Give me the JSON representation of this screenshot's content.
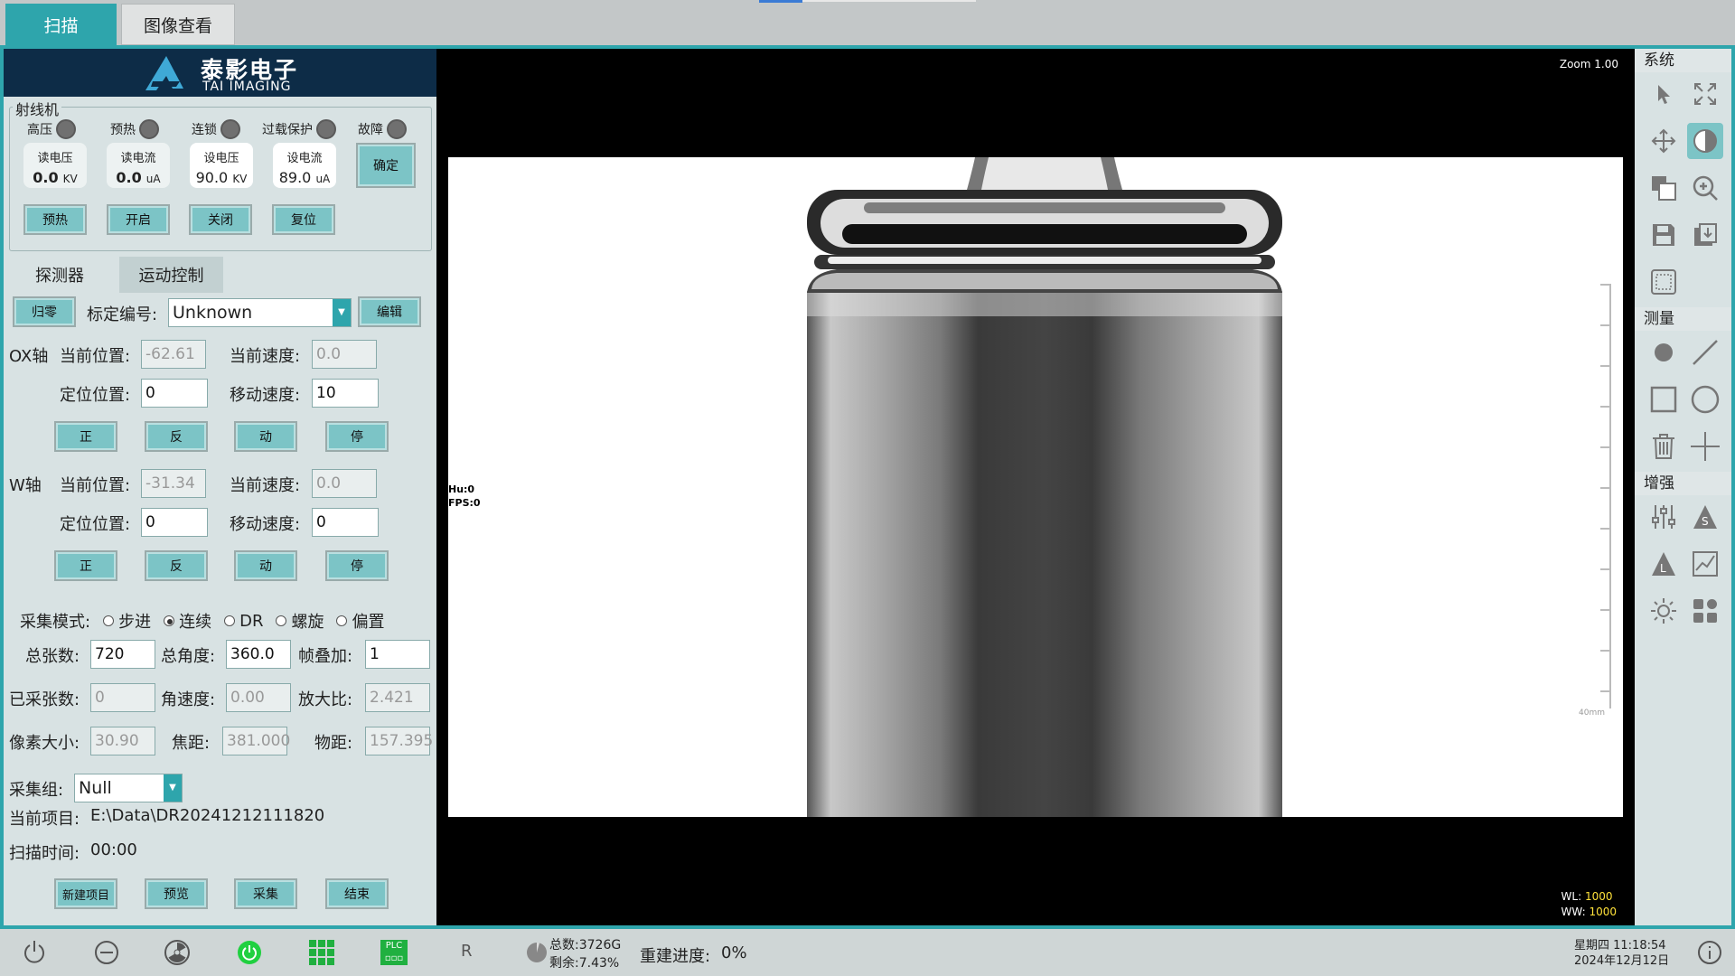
{
  "top_tabs": [
    {
      "label": "扫描"
    },
    {
      "label": "图像查看"
    }
  ],
  "logo": {
    "zh": "泰影电子",
    "en": "TAI IMAGING"
  },
  "xray": {
    "title": "射线机",
    "indicators": [
      {
        "label": "高压"
      },
      {
        "label": "预热"
      },
      {
        "label": "连锁"
      },
      {
        "label": "过载保护"
      },
      {
        "label": "故障"
      }
    ],
    "readouts": [
      {
        "label": "读电压",
        "value": "0.0",
        "unit": "KV"
      },
      {
        "label": "读电流",
        "value": "0.0",
        "unit": "uA"
      },
      {
        "label": "设电压",
        "value": "90.0",
        "unit": "KV"
      },
      {
        "label": "设电流",
        "value": "89.0",
        "unit": "uA"
      }
    ],
    "confirm": "确定",
    "buttons": [
      "预热",
      "开启",
      "关闭",
      "复位"
    ]
  },
  "sub_tabs": [
    {
      "label": "探测器"
    },
    {
      "label": "运动控制"
    }
  ],
  "motion": {
    "home": "归零",
    "calib_label": "标定编号:",
    "calib_value": "Unknown",
    "edit": "编辑",
    "ox": {
      "axis": "OX轴",
      "cur_pos_label": "当前位置:",
      "cur_pos": "-62.61",
      "cur_speed_label": "当前速度:",
      "cur_speed": "0.0",
      "target_label": "定位位置:",
      "target": "0",
      "speed_label": "移动速度:",
      "speed": "10"
    },
    "w": {
      "axis": "W轴",
      "cur_pos_label": "当前位置:",
      "cur_pos": "-31.34",
      "cur_speed_label": "当前速度:",
      "cur_speed": "0.0",
      "target_label": "定位位置:",
      "target": "0",
      "speed_label": "移动速度:",
      "speed": "0"
    },
    "axis_buttons": [
      "正",
      "反",
      "动",
      "停"
    ]
  },
  "acq": {
    "mode_label": "采集模式:",
    "modes": [
      {
        "label": "步进",
        "on": false
      },
      {
        "label": "连续",
        "on": true
      },
      {
        "label": "DR",
        "on": false
      },
      {
        "label": "螺旋",
        "on": false
      },
      {
        "label": "偏置",
        "on": false
      }
    ],
    "total_frames_label": "总张数:",
    "total_frames": "720",
    "total_angle_label": "总角度:",
    "total_angle": "360.0",
    "frame_stack_label": "帧叠加:",
    "frame_stack": "1",
    "acquired_label": "已采张数:",
    "acquired": "0",
    "angle_speed_label": "角速度:",
    "angle_speed": "0.00",
    "mag_label": "放大比:",
    "mag": "2.421",
    "pixel_label": "像素大小:",
    "pixel": "30.90",
    "focal_label": "焦距:",
    "focal": "381.000",
    "obj_label": "物距:",
    "obj": "157.395",
    "group_label": "采集组:",
    "group": "Null",
    "project_label": "当前项目:",
    "project": "E:\\Data\\DR20241212111820",
    "time_label": "扫描时间:",
    "time": "00:00",
    "buttons": [
      "新建项目",
      "预览",
      "采集",
      "结束"
    ]
  },
  "viewer": {
    "zoom": "Zoom 1.00",
    "wl_label": "WL:",
    "wl": "1000",
    "ww_label": "WW:",
    "ww": "1000",
    "hu": "Hu:0",
    "fps": "FPS:0",
    "ruler": "40mm"
  },
  "right": {
    "sections": [
      "系统",
      "测量",
      "增强"
    ]
  },
  "status": {
    "disk_total": "总数:3726G",
    "disk_free": "剩余:7.43%",
    "rebuild_label": "重建进度:",
    "rebuild": "0%",
    "r": "R",
    "plc": "PLC",
    "weekday_time": "星期四   11:18:54",
    "date": "2024年12月12日"
  }
}
